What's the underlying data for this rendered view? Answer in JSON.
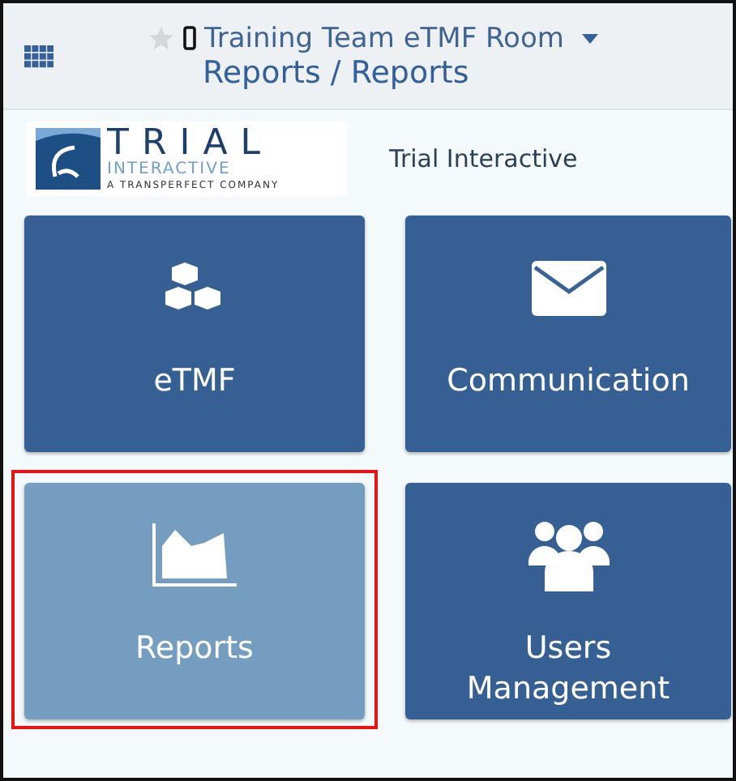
{
  "header": {
    "room": "Training Team eTMF Room",
    "breadcrumb": "Reports / Reports"
  },
  "brand": {
    "logo_word": "TRIAL",
    "logo_sub": "INTERACTIVE",
    "logo_tagline": "A TRANSPERFECT COMPANY",
    "name": "Trial Interactive"
  },
  "tiles": [
    {
      "label": "eTMF",
      "kind": "cubes",
      "selected": false
    },
    {
      "label": "Communication",
      "kind": "envelope",
      "selected": false
    },
    {
      "label": "Reports",
      "kind": "chart",
      "selected": true
    },
    {
      "label": "Users Management",
      "kind": "users",
      "selected": false
    }
  ]
}
